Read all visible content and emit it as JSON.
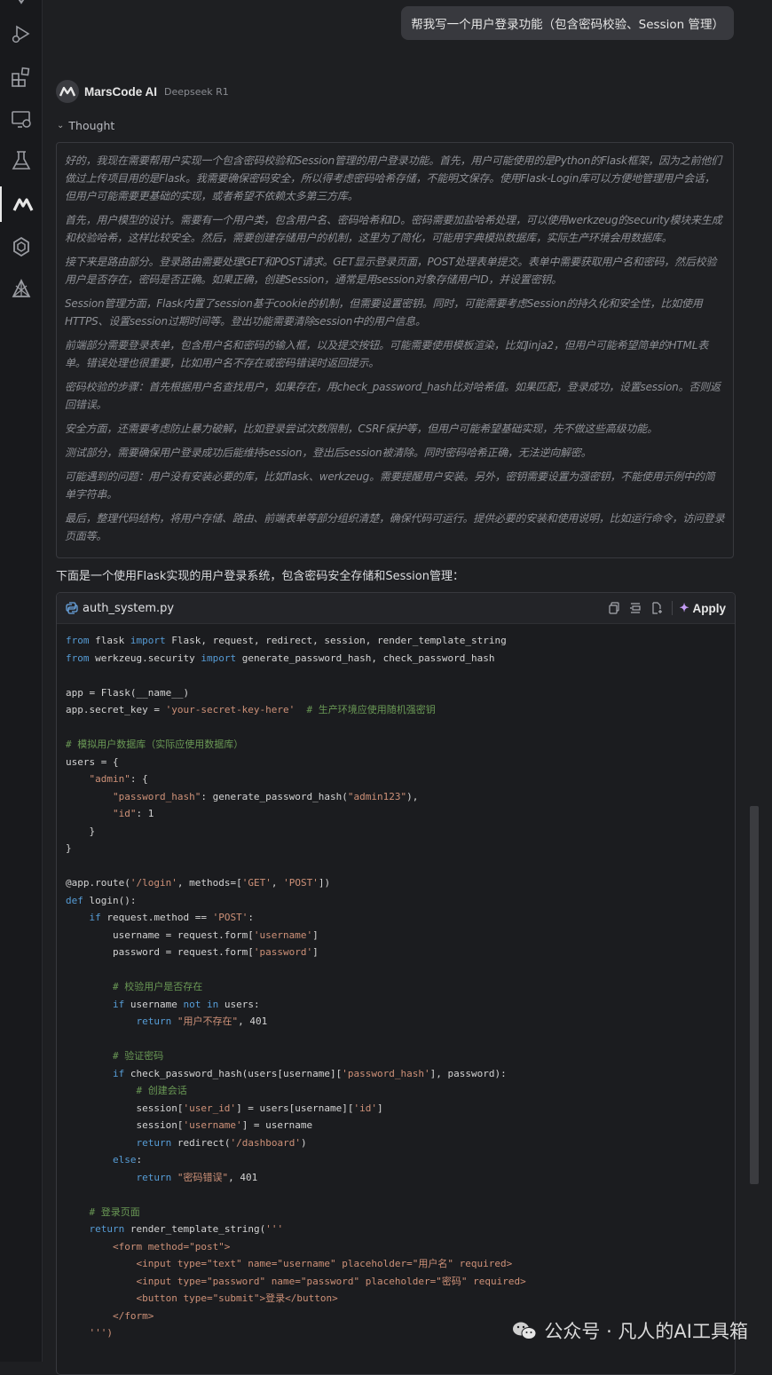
{
  "user_message": "帮我写一个用户登录功能（包含密码校验、Session 管理）",
  "ai": {
    "name": "MarsCode AI",
    "model": "Deepseek R1"
  },
  "thought": {
    "toggle_label": "Thought",
    "paragraphs": [
      "好的，我现在需要帮用户实现一个包含密码校验和Session管理的用户登录功能。首先，用户可能使用的是Python的Flask框架，因为之前他们做过上传项目用的是Flask。我需要确保密码安全，所以得考虑密码哈希存储，不能明文保存。使用Flask-Login库可以方便地管理用户会话，但用户可能需要更基础的实现，或者希望不依赖太多第三方库。",
      "首先，用户模型的设计。需要有一个用户类，包含用户名、密码哈希和ID。密码需要加盐哈希处理，可以使用werkzeug的security模块来生成和校验哈希，这样比较安全。然后，需要创建存储用户的机制，这里为了简化，可能用字典模拟数据库，实际生产环境会用数据库。",
      "接下来是路由部分。登录路由需要处理GET和POST请求。GET显示登录页面，POST处理表单提交。表单中需要获取用户名和密码，然后校验用户是否存在，密码是否正确。如果正确，创建Session，通常是用session对象存储用户ID，并设置密钥。",
      "Session管理方面，Flask内置了session基于cookie的机制，但需要设置密钥。同时，可能需要考虑Session的持久化和安全性，比如使用HTTPS、设置session过期时间等。登出功能需要清除session中的用户信息。",
      "前端部分需要登录表单，包含用户名和密码的输入框，以及提交按钮。可能需要使用模板渲染，比如Jinja2，但用户可能希望简单的HTML表单。错误处理也很重要，比如用户名不存在或密码错误时返回提示。",
      "密码校验的步骤：首先根据用户名查找用户，如果存在，用check_password_hash比对哈希值。如果匹配，登录成功，设置session。否则返回错误。",
      "安全方面，还需要考虑防止暴力破解，比如登录尝试次数限制，CSRF保护等，但用户可能希望基础实现，先不做这些高级功能。",
      "测试部分，需要确保用户登录成功后能维持session，登出后session被清除。同时密码哈希正确，无法逆向解密。",
      "可能遇到的问题：用户没有安装必要的库，比如flask、werkzeug。需要提醒用户安装。另外，密钥需要设置为强密钥，不能使用示例中的简单字符串。",
      "最后，整理代码结构，将用户存储、路由、前端表单等部分组织清楚，确保代码可运行。提供必要的安装和使用说明，比如运行命令，访问登录页面等。"
    ]
  },
  "answer_intro": "下面是一个使用Flask实现的用户登录系统，包含密码安全存储和Session管理：",
  "code_block": {
    "filename": "auth_system.py",
    "apply_label": "Apply",
    "lines": [
      [
        [
          "kw",
          "from"
        ],
        [
          "t",
          " flask "
        ],
        [
          "kw",
          "import"
        ],
        [
          "t",
          " Flask, request, redirect, session, render_template_string"
        ]
      ],
      [
        [
          "kw",
          "from"
        ],
        [
          "t",
          " werkzeug.security "
        ],
        [
          "kw",
          "import"
        ],
        [
          "t",
          " generate_password_hash, check_password_hash"
        ]
      ],
      [],
      [
        [
          "t",
          "app = Flask(__name__)"
        ]
      ],
      [
        [
          "t",
          "app.secret_key = "
        ],
        [
          "str",
          "'your-secret-key-here'"
        ],
        [
          "t",
          "  "
        ],
        [
          "cm",
          "# 生产环境应使用随机强密钥"
        ]
      ],
      [],
      [
        [
          "cm",
          "# 模拟用户数据库（实际应使用数据库）"
        ]
      ],
      [
        [
          "t",
          "users = {"
        ]
      ],
      [
        [
          "t",
          "    "
        ],
        [
          "str",
          "\"admin\""
        ],
        [
          "t",
          ": {"
        ]
      ],
      [
        [
          "t",
          "        "
        ],
        [
          "str",
          "\"password_hash\""
        ],
        [
          "t",
          ": generate_password_hash("
        ],
        [
          "str",
          "\"admin123\""
        ],
        [
          "t",
          "),"
        ]
      ],
      [
        [
          "t",
          "        "
        ],
        [
          "str",
          "\"id\""
        ],
        [
          "t",
          ": 1"
        ]
      ],
      [
        [
          "t",
          "    }"
        ]
      ],
      [
        [
          "t",
          "}"
        ]
      ],
      [],
      [
        [
          "t",
          "@app.route("
        ],
        [
          "str",
          "'/login'"
        ],
        [
          "t",
          ", methods=["
        ],
        [
          "str",
          "'GET'"
        ],
        [
          "t",
          ", "
        ],
        [
          "str",
          "'POST'"
        ],
        [
          "t",
          "])"
        ]
      ],
      [
        [
          "kw",
          "def"
        ],
        [
          "t",
          " login():"
        ]
      ],
      [
        [
          "t",
          "    "
        ],
        [
          "kw",
          "if"
        ],
        [
          "t",
          " request.method == "
        ],
        [
          "str",
          "'POST'"
        ],
        [
          "t",
          ":"
        ]
      ],
      [
        [
          "t",
          "        username = request.form["
        ],
        [
          "str",
          "'username'"
        ],
        [
          "t",
          "]"
        ]
      ],
      [
        [
          "t",
          "        password = request.form["
        ],
        [
          "str",
          "'password'"
        ],
        [
          "t",
          "]"
        ]
      ],
      [],
      [
        [
          "t",
          "        "
        ],
        [
          "cm",
          "# 校验用户是否存在"
        ]
      ],
      [
        [
          "t",
          "        "
        ],
        [
          "kw",
          "if"
        ],
        [
          "t",
          " username "
        ],
        [
          "kw",
          "not in"
        ],
        [
          "t",
          " users:"
        ]
      ],
      [
        [
          "t",
          "            "
        ],
        [
          "kw",
          "return"
        ],
        [
          "t",
          " "
        ],
        [
          "str",
          "\"用户不存在\""
        ],
        [
          "t",
          ", 401"
        ]
      ],
      [],
      [
        [
          "t",
          "        "
        ],
        [
          "cm",
          "# 验证密码"
        ]
      ],
      [
        [
          "t",
          "        "
        ],
        [
          "kw",
          "if"
        ],
        [
          "t",
          " check_password_hash(users[username]["
        ],
        [
          "str",
          "'password_hash'"
        ],
        [
          "t",
          "], password):"
        ]
      ],
      [
        [
          "t",
          "            "
        ],
        [
          "cm",
          "# 创建会话"
        ]
      ],
      [
        [
          "t",
          "            session["
        ],
        [
          "str",
          "'user_id'"
        ],
        [
          "t",
          "] = users[username]["
        ],
        [
          "str",
          "'id'"
        ],
        [
          "t",
          "]"
        ]
      ],
      [
        [
          "t",
          "            session["
        ],
        [
          "str",
          "'username'"
        ],
        [
          "t",
          "] = username"
        ]
      ],
      [
        [
          "t",
          "            "
        ],
        [
          "kw",
          "return"
        ],
        [
          "t",
          " redirect("
        ],
        [
          "str",
          "'/dashboard'"
        ],
        [
          "t",
          ")"
        ]
      ],
      [
        [
          "t",
          "        "
        ],
        [
          "kw",
          "else"
        ],
        [
          "t",
          ":"
        ]
      ],
      [
        [
          "t",
          "            "
        ],
        [
          "kw",
          "return"
        ],
        [
          "t",
          " "
        ],
        [
          "str",
          "\"密码错误\""
        ],
        [
          "t",
          ", 401"
        ]
      ],
      [],
      [
        [
          "t",
          "    "
        ],
        [
          "cm",
          "# 登录页面"
        ]
      ],
      [
        [
          "t",
          "    "
        ],
        [
          "kw",
          "return"
        ],
        [
          "t",
          " render_template_string("
        ],
        [
          "str",
          "'''"
        ]
      ],
      [
        [
          "str",
          "        <form method=\"post\">"
        ]
      ],
      [
        [
          "str",
          "            <input type=\"text\" name=\"username\" placeholder=\"用户名\" required>"
        ]
      ],
      [
        [
          "str",
          "            <input type=\"password\" name=\"password\" placeholder=\"密码\" required>"
        ]
      ],
      [
        [
          "str",
          "            <button type=\"submit\">登录</button>"
        ]
      ],
      [
        [
          "str",
          "        </form>"
        ]
      ],
      [
        [
          "str",
          "    ''')"
        ]
      ]
    ]
  },
  "watermark": "公众号 · 凡人的AI工具箱",
  "colors": {
    "keyword": "#569cd6",
    "string": "#ce9178",
    "comment": "#6a9955",
    "apply_spark": "#c49cf5"
  },
  "activity_icons": [
    "run-debug-icon",
    "extensions-icon",
    "remote-explorer-icon",
    "testing-flask-icon",
    "marscode-icon",
    "openai-icon",
    "perplexity-icon"
  ]
}
